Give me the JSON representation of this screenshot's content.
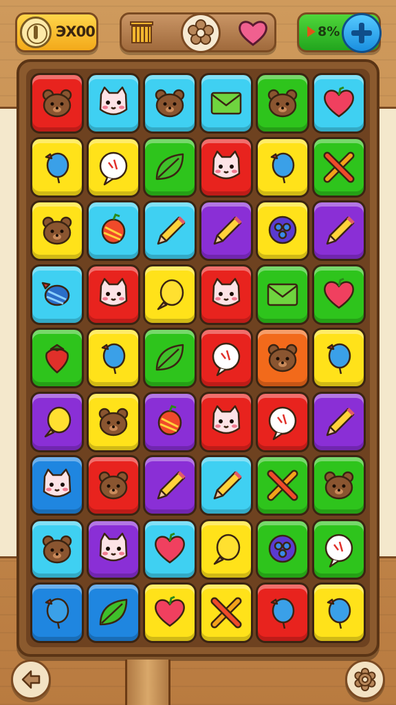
{
  "hud": {
    "coins": "ЭX00",
    "lives": "8%"
  },
  "icons": {
    "coin": "coin-icon",
    "box": "treasure-box-icon",
    "flower": "flower-icon",
    "heart": "heart-icon",
    "play": "play-icon",
    "plus": "plus-icon",
    "back": "arrow-left-icon",
    "settings": "gear-icon"
  },
  "colors": {
    "red": "#e8231e",
    "cyan": "#3fd0f2",
    "yellow": "#ffe21a",
    "green": "#2ec41c",
    "purple": "#8a2fd6",
    "orange": "#f26a1b",
    "blue": "#1f86e0"
  },
  "board": {
    "rows": 9,
    "cols": 6,
    "tiles": [
      [
        [
          "red",
          "bear"
        ],
        [
          "cyan",
          "cat"
        ],
        [
          "cyan",
          "bear"
        ],
        [
          "cyan",
          "envelope"
        ],
        [
          "green",
          "bear"
        ],
        [
          "cyan",
          "heart"
        ]
      ],
      [
        [
          "yellow",
          "balloon"
        ],
        [
          "yellow",
          "bubble"
        ],
        [
          "green",
          "leaf"
        ],
        [
          "red",
          "cat"
        ],
        [
          "yellow",
          "balloon"
        ],
        [
          "green",
          "cross"
        ]
      ],
      [
        [
          "yellow",
          "bear"
        ],
        [
          "cyan",
          "fruit"
        ],
        [
          "cyan",
          "pencil"
        ],
        [
          "purple",
          "pencil"
        ],
        [
          "yellow",
          "berry"
        ],
        [
          "purple",
          "pencil"
        ]
      ],
      [
        [
          "cyan",
          "candy"
        ],
        [
          "red",
          "cat"
        ],
        [
          "yellow",
          "lemon"
        ],
        [
          "red",
          "cat"
        ],
        [
          "green",
          "envelope"
        ],
        [
          "green",
          "heart"
        ]
      ],
      [
        [
          "green",
          "strawberry"
        ],
        [
          "yellow",
          "balloon"
        ],
        [
          "green",
          "leaf"
        ],
        [
          "red",
          "bubble"
        ],
        [
          "orange",
          "bear"
        ],
        [
          "yellow",
          "balloon"
        ]
      ],
      [
        [
          "purple",
          "lemon"
        ],
        [
          "yellow",
          "bear"
        ],
        [
          "purple",
          "fruit"
        ],
        [
          "red",
          "cat"
        ],
        [
          "red",
          "bubble"
        ],
        [
          "purple",
          "pencil"
        ]
      ],
      [
        [
          "blue",
          "cat"
        ],
        [
          "red",
          "bear"
        ],
        [
          "purple",
          "pencil"
        ],
        [
          "cyan",
          "pencil"
        ],
        [
          "green",
          "cross"
        ],
        [
          "green",
          "bear"
        ]
      ],
      [
        [
          "cyan",
          "bear"
        ],
        [
          "purple",
          "cat"
        ],
        [
          "cyan",
          "heart"
        ],
        [
          "yellow",
          "lemon"
        ],
        [
          "green",
          "berry"
        ],
        [
          "green",
          "bubble"
        ]
      ],
      [
        [
          "blue",
          "balloon"
        ],
        [
          "blue",
          "leaf"
        ],
        [
          "yellow",
          "heart"
        ],
        [
          "yellow",
          "cross"
        ],
        [
          "red",
          "balloon"
        ],
        [
          "yellow",
          "balloon"
        ]
      ]
    ]
  }
}
